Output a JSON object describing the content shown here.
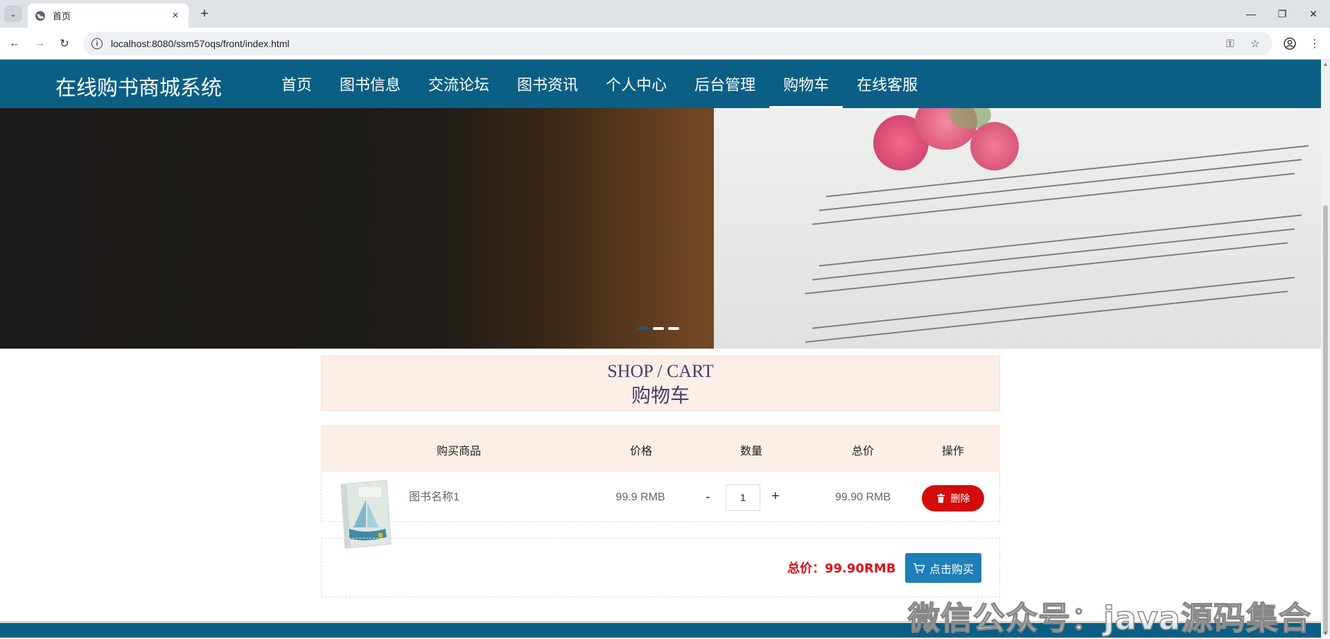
{
  "browser": {
    "tab_title": "首页",
    "url": "localhost:8080/ssm57oqs/front/index.html"
  },
  "site": {
    "title": "在线购书商城系统",
    "nav": [
      {
        "label": "首页"
      },
      {
        "label": "图书信息"
      },
      {
        "label": "交流论坛"
      },
      {
        "label": "图书资讯"
      },
      {
        "label": "个人中心"
      },
      {
        "label": "后台管理"
      },
      {
        "label": "购物车",
        "active": true
      },
      {
        "label": "在线客服"
      }
    ],
    "accent_color": "#0b5f84"
  },
  "banner": {
    "slide_count": 3,
    "active_slide": 1
  },
  "cart": {
    "heading_en": "SHOP / CART",
    "heading_zh": "购物车",
    "columns": {
      "product": "购买商品",
      "price": "价格",
      "quantity": "数量",
      "subtotal": "总价",
      "action": "操作"
    },
    "items": [
      {
        "name": "图书名称1",
        "price": "99.9 RMB",
        "quantity": "1",
        "subtotal": "99.90 RMB",
        "delete_label": "删除",
        "minus_label": "-",
        "plus_label": "+"
      }
    ],
    "total_label": "总价：",
    "total_value": "99.90RMB",
    "buy_label": "点击购买"
  },
  "watermark": "微信公众号：java源码集合"
}
